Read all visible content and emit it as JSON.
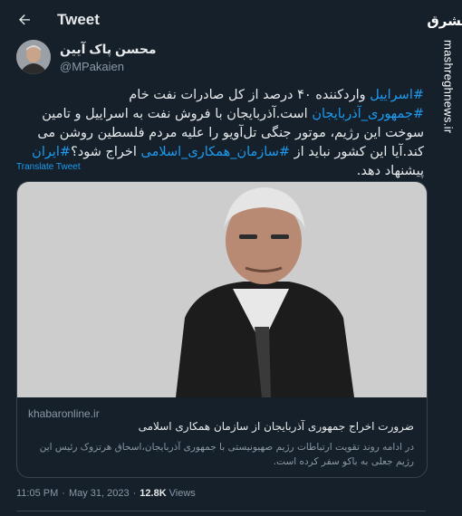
{
  "header": {
    "title": "Tweet",
    "back_icon": "arrow-left-icon"
  },
  "watermark": {
    "logo_text": "مشرق",
    "url_text": "mashreghnews.ir"
  },
  "author": {
    "display_name": "محسن پاک آیین",
    "handle": "@MPakaien"
  },
  "tweet": {
    "segments": [
      {
        "text": "#اسراییل",
        "type": "hashtag"
      },
      {
        "text": " واردکننده ۴۰ درصد از کل صادرات نفت خام ",
        "type": "text"
      },
      {
        "text": "#جمهوری_آذربایجان",
        "type": "hashtag"
      },
      {
        "text": " است.آذربایجان با فروش نفت به اسراییل و تامین سوخت این رژیم، موتور جنگی تل‌آویو را علیه مردم فلسطین روشن می کند.آیا این کشور نباید از ",
        "type": "text"
      },
      {
        "text": "#سازمان_همکاری_اسلامی",
        "type": "hashtag"
      },
      {
        "text": " اخراج شود؟",
        "type": "text"
      },
      {
        "text": "#ایران",
        "type": "hashtag"
      },
      {
        "text": " پیشنهاد دهد.",
        "type": "text"
      }
    ],
    "translate_label": "Translate Tweet"
  },
  "card": {
    "domain": "khabaronline.ir",
    "title": "ضرورت اخراج جمهوری آذربایجان از سازمان همکاری اسلامی",
    "description": "در ادامه روند تقویت ارتباطات رژیم صهیونیستی با جمهوری آذربایجان،اسحاق هرتزوک رئیس این رژیم جعلی به باکو سفر کرده است."
  },
  "meta": {
    "time": "11:05 PM",
    "date": "May 31, 2023",
    "views_count": "12.8K",
    "views_label": "Views"
  },
  "colors": {
    "background": "#15202b",
    "accent": "#1d9bf0",
    "secondary_text": "#8b98a5",
    "border": "#38444d"
  }
}
